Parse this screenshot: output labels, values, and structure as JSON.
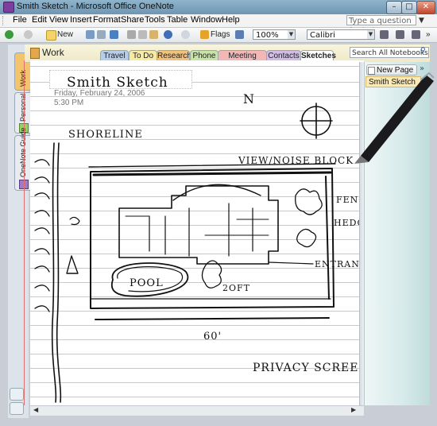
{
  "window": {
    "title": "Smith Sketch - Microsoft Office OneNote"
  },
  "menu": [
    "File",
    "Edit",
    "View",
    "Insert",
    "Format",
    "Share",
    "Tools",
    "Table",
    "Window",
    "Help"
  ],
  "help_placeholder": "Type a question for help",
  "toolbar": {
    "new_label": "New",
    "flags_label": "Flags",
    "zoom": "100%",
    "font": "Calibri"
  },
  "notebook": {
    "title": "Work"
  },
  "notebooks_nav": [
    "Work",
    "Personal",
    "OneNote Guide"
  ],
  "sections": [
    {
      "label": "Travel",
      "color": "#b7cde9"
    },
    {
      "label": "To Do",
      "color": "#f7eaa3"
    },
    {
      "label": "Research",
      "color": "#f1c27d"
    },
    {
      "label": "Phone",
      "color": "#c8e2a8"
    },
    {
      "label": "Meeting Notes",
      "color": "#f2b8b8"
    },
    {
      "label": "Contacts",
      "color": "#d2bce6"
    },
    {
      "label": "Sketches",
      "color": "#ffffff"
    }
  ],
  "search_placeholder": "Search All Notebooks",
  "page": {
    "title": "Smith Sketch",
    "date": "Friday, February 24, 2006",
    "time": "5:30 PM"
  },
  "sketch_labels": {
    "north": "N",
    "shoreline": "SHORELINE",
    "view_block": "VIEW/NOISE BLOCK",
    "fence": "FENCE",
    "hedge": "HEDGE",
    "entrance": "ENTRANCE",
    "pool": "POOL",
    "dim_side": "2OFT",
    "dim_width": "60'",
    "privacy": "PRIVACY SCREEN"
  },
  "pages_panel": {
    "new_page": "New Page",
    "items": [
      "Smith Sketch"
    ]
  }
}
